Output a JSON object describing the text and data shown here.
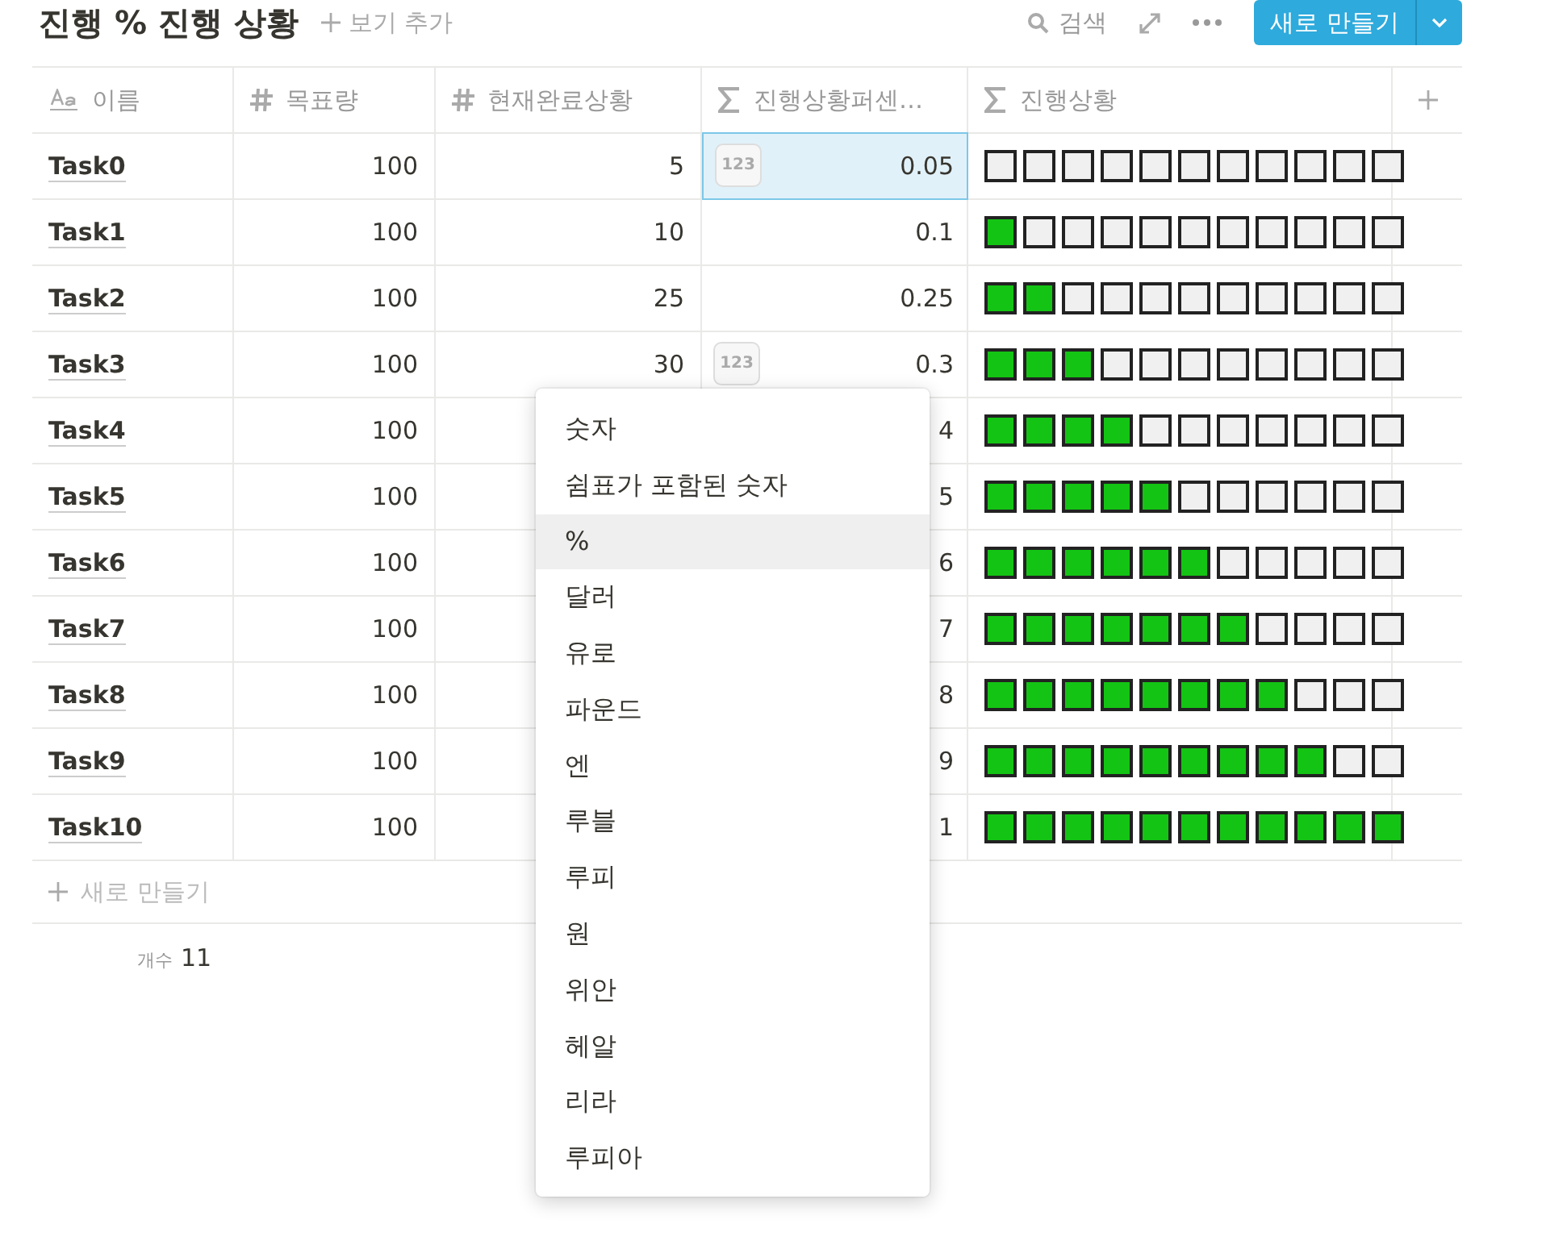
{
  "header": {
    "title": "진행 % 진행 상황",
    "add_view": "보기 추가",
    "search": "검색",
    "new_button": "새로 만들기"
  },
  "columns": [
    {
      "kind": "title",
      "label": "이름"
    },
    {
      "kind": "number",
      "label": "목표량"
    },
    {
      "kind": "number",
      "label": "현재완료상황"
    },
    {
      "kind": "formula",
      "label": "진행상황퍼센…"
    },
    {
      "kind": "formula",
      "label": "진행상황"
    }
  ],
  "rows": [
    {
      "name": "Task0",
      "goal": "100",
      "current": "5",
      "percent": "0.05",
      "percent_selected": true,
      "badge": "123",
      "squares": [
        false,
        false,
        false,
        false,
        false,
        false,
        false,
        false,
        false,
        false,
        false
      ]
    },
    {
      "name": "Task1",
      "goal": "100",
      "current": "10",
      "percent": "0.1",
      "percent_selected": false,
      "squares": [
        true,
        false,
        false,
        false,
        false,
        false,
        false,
        false,
        false,
        false,
        false
      ]
    },
    {
      "name": "Task2",
      "goal": "100",
      "current": "25",
      "percent": "0.25",
      "percent_selected": false,
      "squares": [
        true,
        true,
        false,
        false,
        false,
        false,
        false,
        false,
        false,
        false,
        false
      ]
    },
    {
      "name": "Task3",
      "goal": "100",
      "current": "30",
      "percent": "0.3",
      "percent_selected": false,
      "badge": "123",
      "squares": [
        true,
        true,
        true,
        false,
        false,
        false,
        false,
        false,
        false,
        false,
        false
      ]
    },
    {
      "name": "Task4",
      "goal": "100",
      "percent": "4",
      "percent_selected": false,
      "squares": [
        true,
        true,
        true,
        true,
        false,
        false,
        false,
        false,
        false,
        false,
        false
      ]
    },
    {
      "name": "Task5",
      "goal": "100",
      "percent": "5",
      "percent_selected": false,
      "squares": [
        true,
        true,
        true,
        true,
        true,
        false,
        false,
        false,
        false,
        false,
        false
      ]
    },
    {
      "name": "Task6",
      "goal": "100",
      "percent": "6",
      "percent_selected": false,
      "squares": [
        true,
        true,
        true,
        true,
        true,
        true,
        false,
        false,
        false,
        false,
        false
      ]
    },
    {
      "name": "Task7",
      "goal": "100",
      "percent": "7",
      "percent_selected": false,
      "squares": [
        true,
        true,
        true,
        true,
        true,
        true,
        true,
        false,
        false,
        false,
        false
      ]
    },
    {
      "name": "Task8",
      "goal": "100",
      "percent": "8",
      "percent_selected": false,
      "squares": [
        true,
        true,
        true,
        true,
        true,
        true,
        true,
        true,
        false,
        false,
        false
      ]
    },
    {
      "name": "Task9",
      "goal": "100",
      "percent": "9",
      "percent_selected": false,
      "squares": [
        true,
        true,
        true,
        true,
        true,
        true,
        true,
        true,
        true,
        false,
        false
      ]
    },
    {
      "name": "Task10",
      "goal": "100",
      "percent": "1",
      "percent_selected": false,
      "squares": [
        true,
        true,
        true,
        true,
        true,
        true,
        true,
        true,
        true,
        true,
        true
      ]
    }
  ],
  "new_row": "새로 만들기",
  "footer": {
    "label": "개수",
    "value": "11"
  },
  "menu": [
    {
      "label": "숫자",
      "selected": false
    },
    {
      "label": "쉼표가 포함된 숫자",
      "selected": false
    },
    {
      "label": "%",
      "selected": true
    },
    {
      "label": "달러",
      "selected": false
    },
    {
      "label": "유로",
      "selected": false
    },
    {
      "label": "파운드",
      "selected": false
    },
    {
      "label": "엔",
      "selected": false
    },
    {
      "label": "루블",
      "selected": false
    },
    {
      "label": "루피",
      "selected": false
    },
    {
      "label": "원",
      "selected": false
    },
    {
      "label": "위안",
      "selected": false
    },
    {
      "label": "헤알",
      "selected": false
    },
    {
      "label": "리라",
      "selected": false
    },
    {
      "label": "루피아",
      "selected": false
    }
  ]
}
